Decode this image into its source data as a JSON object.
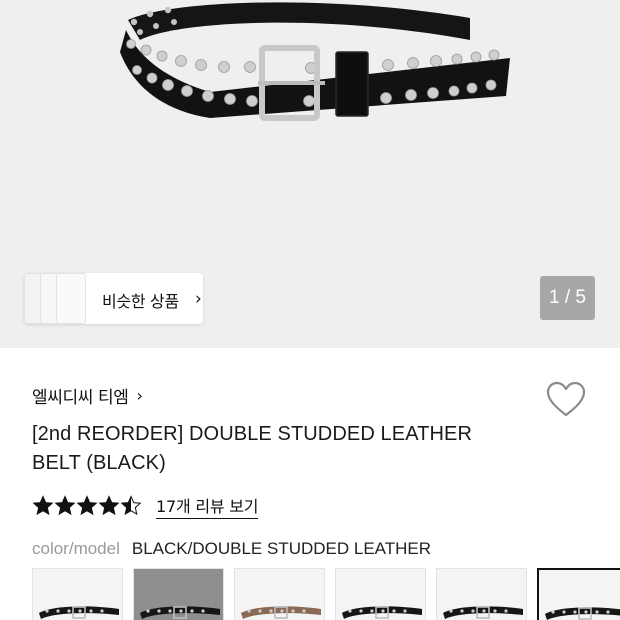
{
  "gallery": {
    "pager_text": "1 / 5",
    "similar_button_label": "비슷한 상품",
    "similar_chevron": "›"
  },
  "product": {
    "brand": "엘씨디씨 티엠",
    "brand_chevron": "›",
    "title_line1": "[2nd REORDER] DOUBLE STUDDED LEATHER",
    "title_line2": "BELT (BLACK)",
    "rating": 4.5,
    "review_link": "17개 리뷰 보기",
    "option_key": "color/model",
    "option_value": "BLACK/DOUBLE STUDDED LEATHER"
  },
  "swatches": [
    {
      "name": "black-double-studded",
      "tone": "black",
      "bg": "#f4f4f4",
      "selected": false
    },
    {
      "name": "grey-background-variant",
      "tone": "black",
      "bg": "#8f8f8f",
      "selected": false
    },
    {
      "name": "brown-studded",
      "tone": "brown",
      "bg": "#f4f4f4",
      "selected": false
    },
    {
      "name": "black-studded-2",
      "tone": "black",
      "bg": "#f4f4f4",
      "selected": false
    },
    {
      "name": "black-studded-3",
      "tone": "black",
      "bg": "#f4f4f4",
      "selected": false
    },
    {
      "name": "black-studded-selected",
      "tone": "black",
      "bg": "#f4f4f4",
      "selected": true
    }
  ],
  "colors": {
    "belt": "#141414",
    "stud": "#c9c9c9",
    "pager_bg": "#a7a7a7",
    "hero_bg": "#efefef"
  }
}
